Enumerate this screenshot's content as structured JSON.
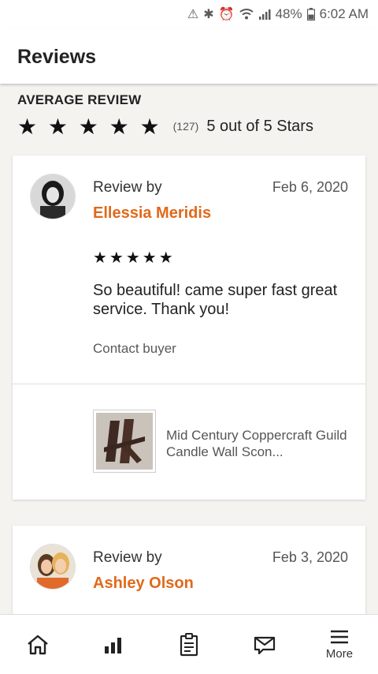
{
  "status_bar": {
    "battery": "48%",
    "time": "6:02 AM"
  },
  "header": {
    "title": "Reviews"
  },
  "average": {
    "label": "AVERAGE REVIEW",
    "stars": "★ ★ ★ ★ ★",
    "rating": 5,
    "count": "(127)",
    "text": "5 out of 5 Stars"
  },
  "reviews": [
    {
      "review_by": "Review by",
      "reviewer": "Ellessia Meridis",
      "date": "Feb 6, 2020",
      "stars": "★★★★★",
      "rating": 5,
      "text": "So beautiful! came super fast great service. Thank you!",
      "contact": "Contact buyer",
      "item_title": "Mid Century Coppercraft Guild Candle Wall Scon..."
    },
    {
      "review_by": "Review by",
      "reviewer": "Ashley Olson",
      "date": "Feb 3, 2020"
    }
  ],
  "nav": {
    "more_label": "More"
  },
  "colors": {
    "reviewer_name": "#e0691a",
    "background": "#f4f3f0"
  },
  "icons": [
    "home-icon",
    "stats-icon",
    "orders-icon",
    "messages-icon",
    "menu-icon"
  ]
}
